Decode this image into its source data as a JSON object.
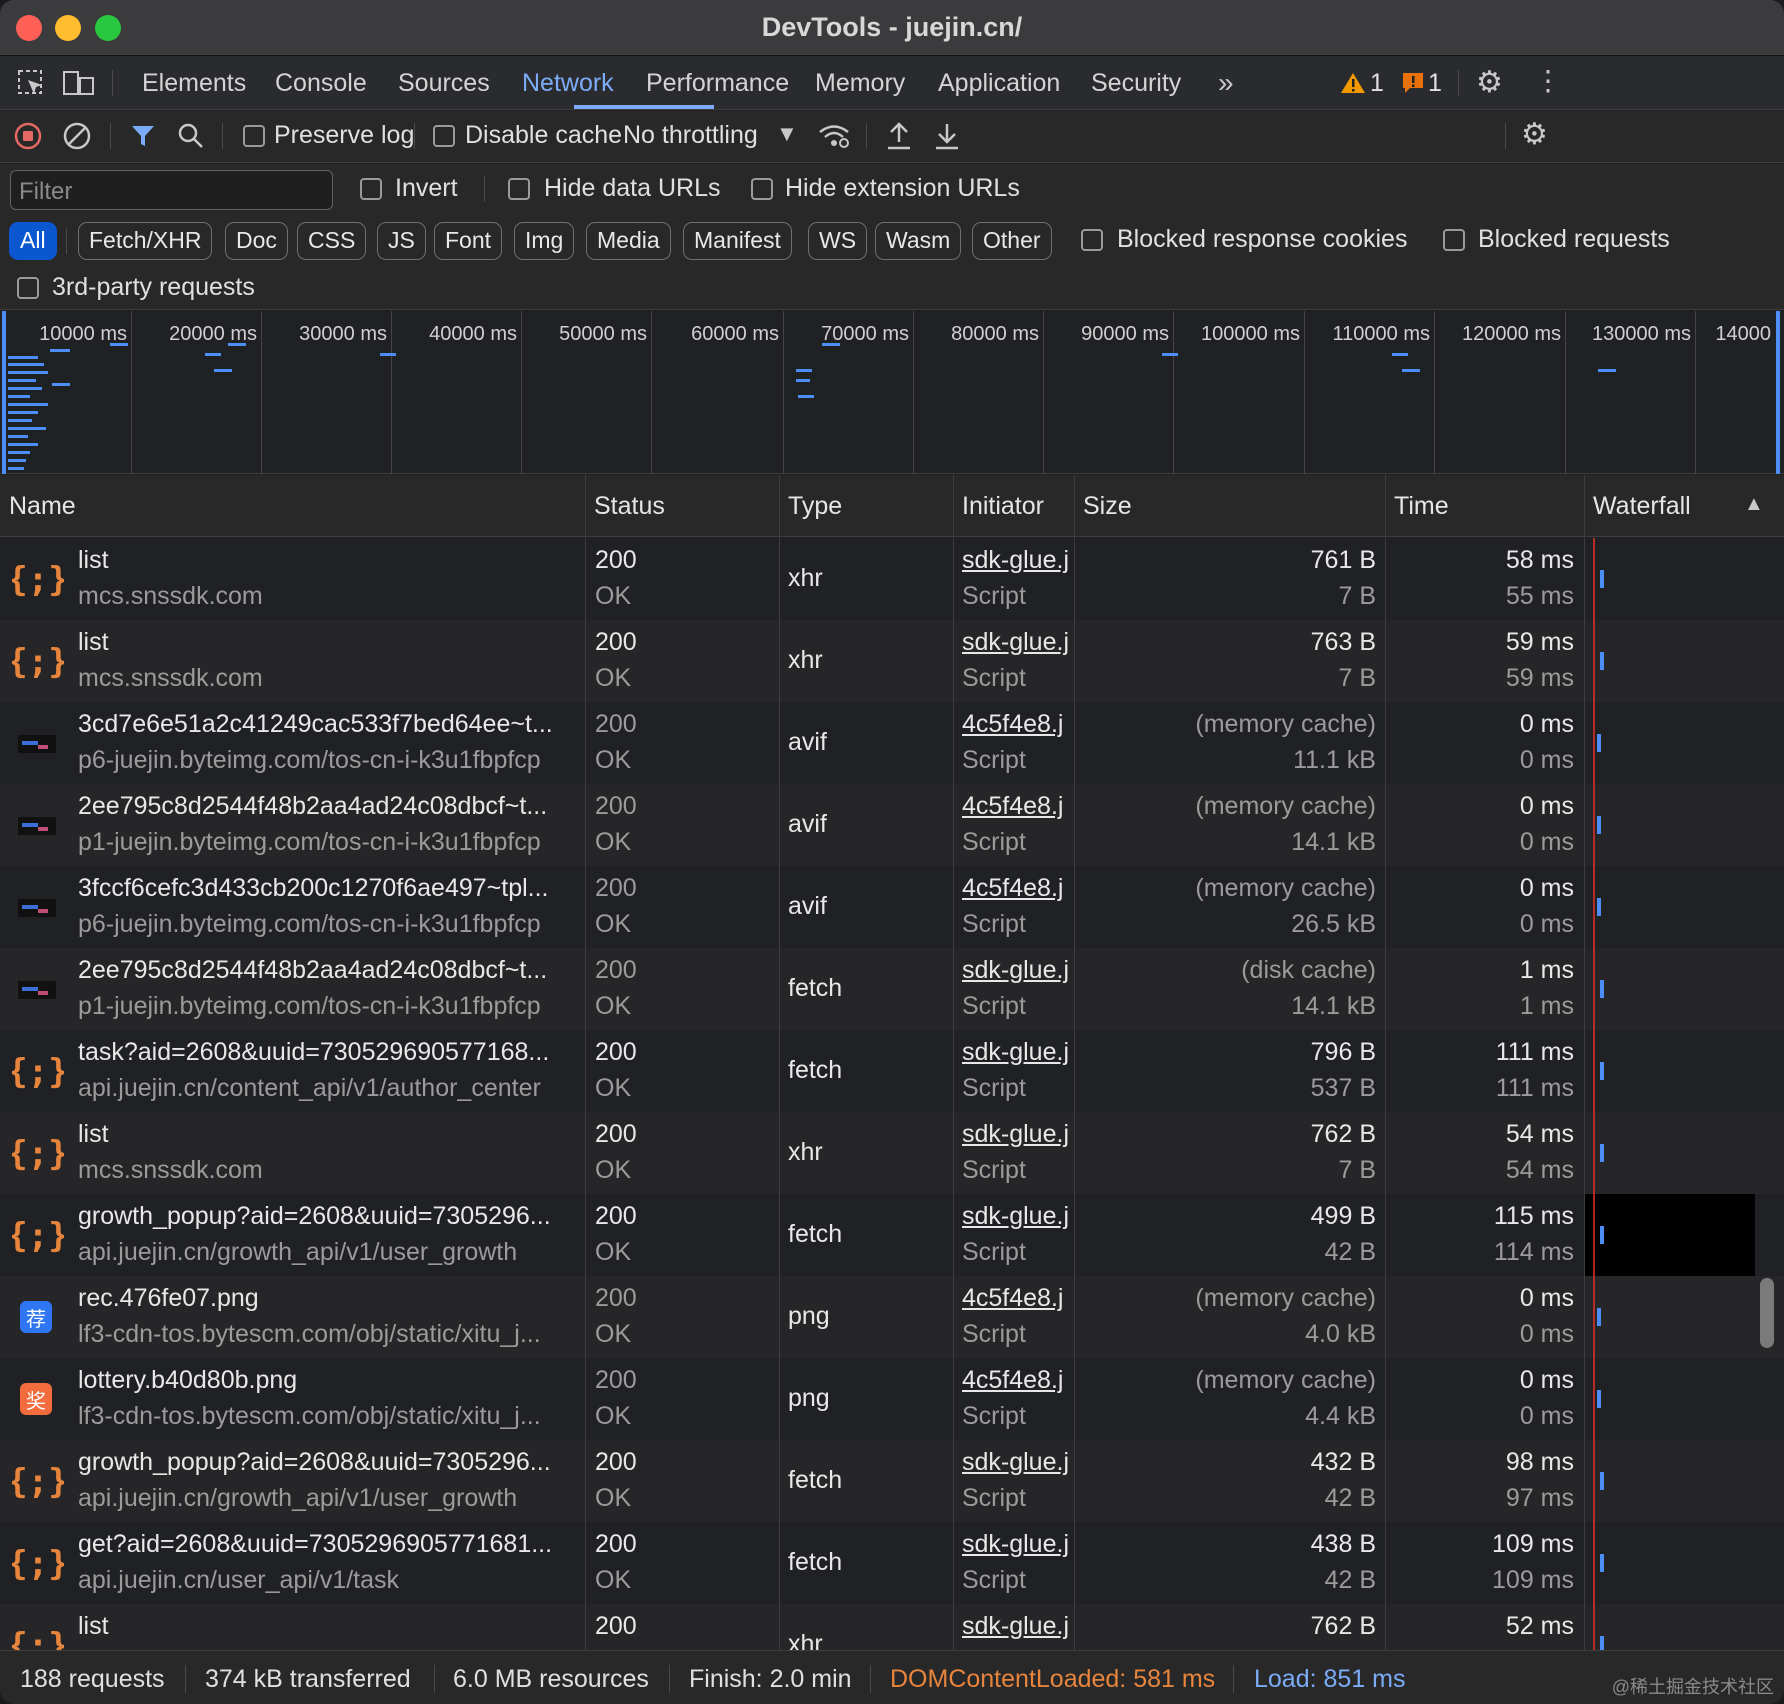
{
  "window": {
    "title": "DevTools - juejin.cn/"
  },
  "tabs": [
    "Elements",
    "Console",
    "Sources",
    "Network",
    "Performance",
    "Memory",
    "Application",
    "Security"
  ],
  "active_tab": "Network",
  "badges": {
    "warnings": "1",
    "issues": "1"
  },
  "toolbar": {
    "preserve_log": "Preserve log",
    "disable_cache": "Disable cache",
    "throttling": "No throttling"
  },
  "filter": {
    "placeholder": "Filter",
    "invert": "Invert",
    "hide_data_urls": "Hide data URLs",
    "hide_extension_urls": "Hide extension URLs",
    "types": [
      "All",
      "Fetch/XHR",
      "Doc",
      "CSS",
      "JS",
      "Font",
      "Img",
      "Media",
      "Manifest",
      "WS",
      "Wasm",
      "Other"
    ],
    "blocked_response_cookies": "Blocked response cookies",
    "blocked_requests": "Blocked requests",
    "third_party": "3rd-party requests"
  },
  "overview_ticks": [
    "10000 ms",
    "20000 ms",
    "30000 ms",
    "40000 ms",
    "50000 ms",
    "60000 ms",
    "70000 ms",
    "80000 ms",
    "90000 ms",
    "100000 ms",
    "110000 ms",
    "120000 ms",
    "130000 ms",
    "14000"
  ],
  "columns": {
    "name": "Name",
    "status": "Status",
    "type": "Type",
    "initiator": "Initiator",
    "size": "Size",
    "time": "Time",
    "waterfall": "Waterfall"
  },
  "requests": [
    {
      "icon": "xhr-icon",
      "name": "list",
      "domain": "mcs.snssdk.com",
      "status": "200",
      "status_text": "OK",
      "type": "xhr",
      "initiator": "sdk-glue.j",
      "initiator_type": "Script",
      "size": "761 B",
      "size2": "7 B",
      "time": "58 ms",
      "time2": "55 ms",
      "dimmed": false
    },
    {
      "icon": "xhr-icon",
      "name": "list",
      "domain": "mcs.snssdk.com",
      "status": "200",
      "status_text": "OK",
      "type": "xhr",
      "initiator": "sdk-glue.j",
      "initiator_type": "Script",
      "size": "763 B",
      "size2": "7 B",
      "time": "59 ms",
      "time2": "59 ms",
      "dimmed": false
    },
    {
      "icon": "image-thumb-icon",
      "name": "3cd7e6e51a2c41249cac533f7bed64ee~t...",
      "domain": "p6-juejin.byteimg.com/tos-cn-i-k3u1fbpfcp",
      "status": "200",
      "status_text": "OK",
      "type": "avif",
      "initiator": "4c5f4e8.j",
      "initiator_type": "Script",
      "size": "(memory cache)",
      "size2": "11.1 kB",
      "time": "0 ms",
      "time2": "0 ms",
      "dimmed": true
    },
    {
      "icon": "image-thumb-icon",
      "name": "2ee795c8d2544f48b2aa4ad24c08dbcf~t...",
      "domain": "p1-juejin.byteimg.com/tos-cn-i-k3u1fbpfcp",
      "status": "200",
      "status_text": "OK",
      "type": "avif",
      "initiator": "4c5f4e8.j",
      "initiator_type": "Script",
      "size": "(memory cache)",
      "size2": "14.1 kB",
      "time": "0 ms",
      "time2": "0 ms",
      "dimmed": true
    },
    {
      "icon": "image-thumb-icon",
      "name": "3fccf6cefc3d433cb200c1270f6ae497~tpl...",
      "domain": "p6-juejin.byteimg.com/tos-cn-i-k3u1fbpfcp",
      "status": "200",
      "status_text": "OK",
      "type": "avif",
      "initiator": "4c5f4e8.j",
      "initiator_type": "Script",
      "size": "(memory cache)",
      "size2": "26.5 kB",
      "time": "0 ms",
      "time2": "0 ms",
      "dimmed": true
    },
    {
      "icon": "image-thumb-icon",
      "name": "2ee795c8d2544f48b2aa4ad24c08dbcf~t...",
      "domain": "p1-juejin.byteimg.com/tos-cn-i-k3u1fbpfcp",
      "status": "200",
      "status_text": "OK",
      "type": "fetch",
      "initiator": "sdk-glue.j",
      "initiator_type": "Script",
      "size": "(disk cache)",
      "size2": "14.1 kB",
      "time": "1 ms",
      "time2": "1 ms",
      "dimmed": true
    },
    {
      "icon": "xhr-icon",
      "name": "task?aid=2608&uuid=730529690577168...",
      "domain": "api.juejin.cn/content_api/v1/author_center",
      "status": "200",
      "status_text": "OK",
      "type": "fetch",
      "initiator": "sdk-glue.j",
      "initiator_type": "Script",
      "size": "796 B",
      "size2": "537 B",
      "time": "111 ms",
      "time2": "111 ms",
      "dimmed": false
    },
    {
      "icon": "xhr-icon",
      "name": "list",
      "domain": "mcs.snssdk.com",
      "status": "200",
      "status_text": "OK",
      "type": "xhr",
      "initiator": "sdk-glue.j",
      "initiator_type": "Script",
      "size": "762 B",
      "size2": "7 B",
      "time": "54 ms",
      "time2": "54 ms",
      "dimmed": false
    },
    {
      "icon": "xhr-icon",
      "name": "growth_popup?aid=2608&uuid=7305296...",
      "domain": "api.juejin.cn/growth_api/v1/user_growth",
      "status": "200",
      "status_text": "OK",
      "type": "fetch",
      "initiator": "sdk-glue.j",
      "initiator_type": "Script",
      "size": "499 B",
      "size2": "42 B",
      "time": "115 ms",
      "time2": "114 ms",
      "dimmed": false
    },
    {
      "icon": "png-rec-icon",
      "name": "rec.476fe07.png",
      "domain": "lf3-cdn-tos.bytescm.com/obj/static/xitu_j...",
      "status": "200",
      "status_text": "OK",
      "type": "png",
      "initiator": "4c5f4e8.j",
      "initiator_type": "Script",
      "size": "(memory cache)",
      "size2": "4.0 kB",
      "time": "0 ms",
      "time2": "0 ms",
      "dimmed": true
    },
    {
      "icon": "png-lottery-icon",
      "name": "lottery.b40d80b.png",
      "domain": "lf3-cdn-tos.bytescm.com/obj/static/xitu_j...",
      "status": "200",
      "status_text": "OK",
      "type": "png",
      "initiator": "4c5f4e8.j",
      "initiator_type": "Script",
      "size": "(memory cache)",
      "size2": "4.4 kB",
      "time": "0 ms",
      "time2": "0 ms",
      "dimmed": true
    },
    {
      "icon": "xhr-icon",
      "name": "growth_popup?aid=2608&uuid=7305296...",
      "domain": "api.juejin.cn/growth_api/v1/user_growth",
      "status": "200",
      "status_text": "OK",
      "type": "fetch",
      "initiator": "sdk-glue.j",
      "initiator_type": "Script",
      "size": "432 B",
      "size2": "42 B",
      "time": "98 ms",
      "time2": "97 ms",
      "dimmed": false
    },
    {
      "icon": "xhr-icon",
      "name": "get?aid=2608&uuid=7305296905771681...",
      "domain": "api.juejin.cn/user_api/v1/task",
      "status": "200",
      "status_text": "OK",
      "type": "fetch",
      "initiator": "sdk-glue.j",
      "initiator_type": "Script",
      "size": "438 B",
      "size2": "42 B",
      "time": "109 ms",
      "time2": "109 ms",
      "dimmed": false
    },
    {
      "icon": "xhr-icon",
      "name": "list",
      "domain": "",
      "status": "200",
      "status_text": "",
      "type": "xhr",
      "initiator": "sdk-glue.j",
      "initiator_type": "",
      "size": "762 B",
      "size2": "",
      "time": "52 ms",
      "time2": "",
      "dimmed": false
    }
  ],
  "status": {
    "requests": "188 requests",
    "transferred": "374 kB transferred",
    "resources": "6.0 MB resources",
    "finish": "Finish: 2.0 min",
    "dcl": "DOMContentLoaded: 581 ms",
    "load": "Load: 851 ms"
  },
  "watermark": "@稀土掘金技术社区",
  "colors": {
    "accent": "#7cacf8",
    "dcl": "#e8853d",
    "waterfall_bar": "#4d8df6"
  }
}
